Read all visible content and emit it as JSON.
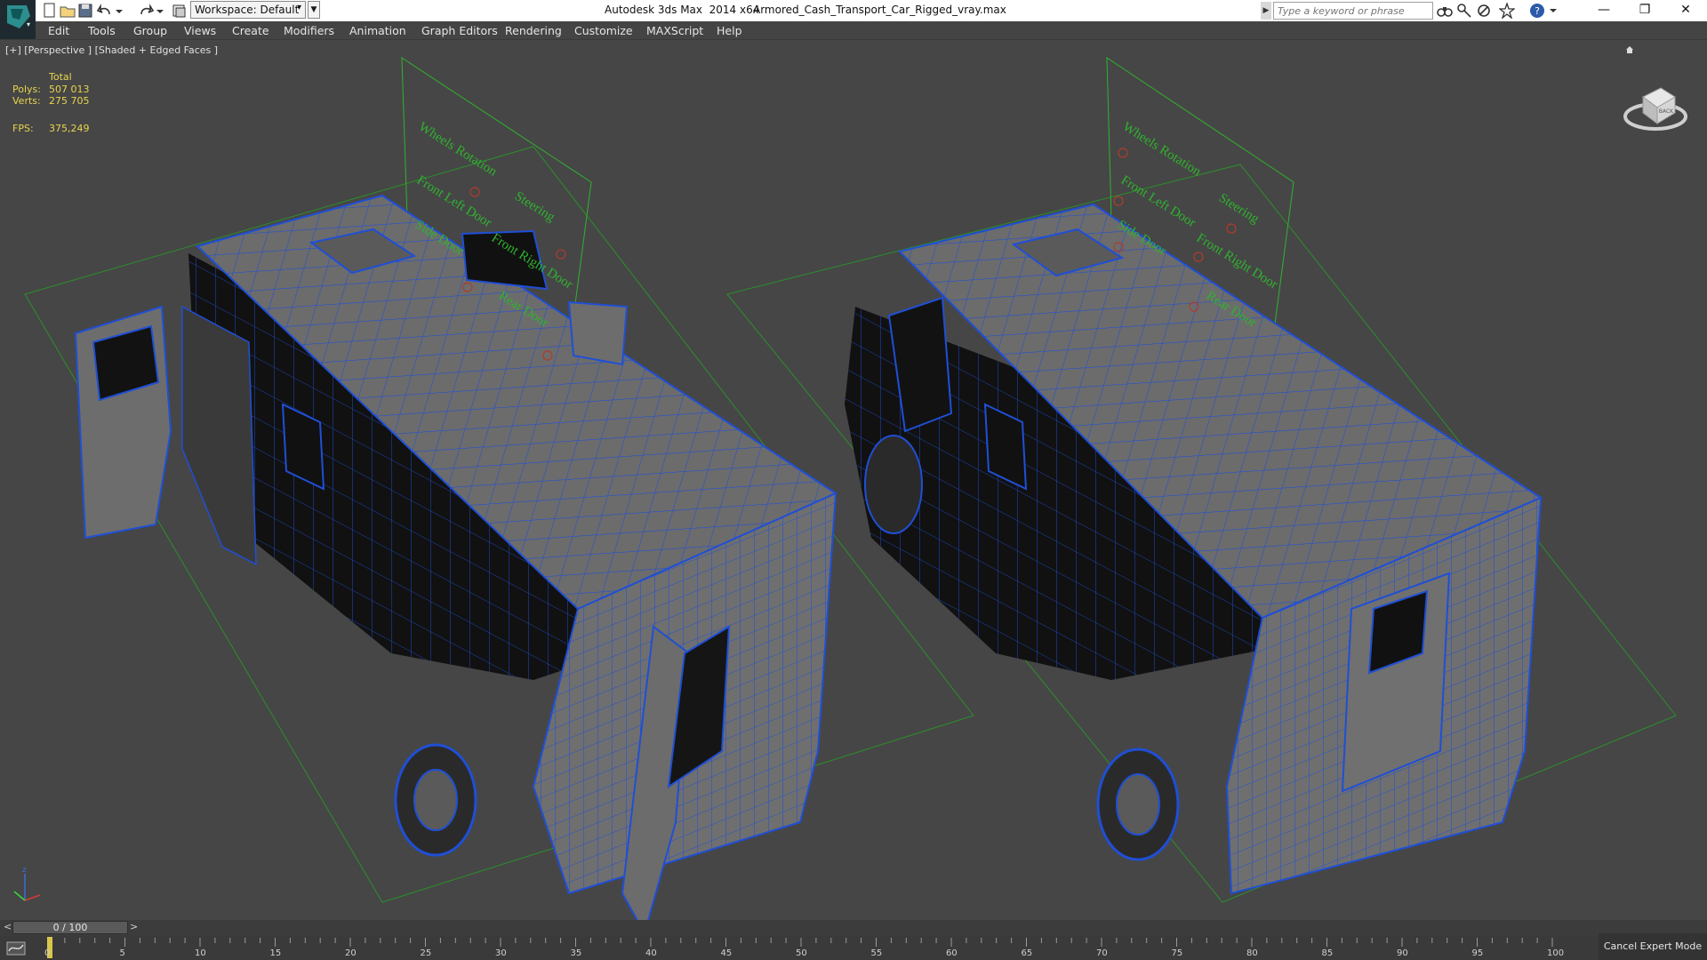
{
  "titlebar": {
    "workspace_label": "Workspace: Default",
    "app_title": "Autodesk 3ds Max  2014 x64",
    "file_title": "Armored_Cash_Transport_Car_Rigged_vray.max",
    "search_placeholder": "Type a keyword or phrase"
  },
  "menu": [
    "Edit",
    "Tools",
    "Group",
    "Views",
    "Create",
    "Modifiers",
    "Animation",
    "Graph Editors",
    "Rendering",
    "Customize",
    "MAXScript",
    "Help"
  ],
  "viewport": {
    "label": "[+] [Perspective ] [Shaded + Edged Faces ]",
    "stats": {
      "total_label": "Total",
      "polys_label": "Polys:",
      "polys_value": "507 013",
      "verts_label": "Verts:",
      "verts_value": "275 705",
      "fps_label": "FPS:",
      "fps_value": "375,249"
    },
    "rig_labels_left": [
      "Wheels Rotation",
      "Front Left Door",
      "Side Door",
      "Steering",
      "Front Right Door",
      "Rear Door"
    ],
    "rig_labels_right": [
      "Wheels Rotation",
      "Front Left Door",
      "Side Door",
      "Steering",
      "Front Right Door",
      "Rear Door"
    ],
    "viewcube_face": "BACK"
  },
  "timeline": {
    "frame_display": "0 / 100",
    "ticks": [
      "0",
      "5",
      "10",
      "15",
      "20",
      "25",
      "30",
      "35",
      "40",
      "45",
      "50",
      "55",
      "60",
      "65",
      "70",
      "75",
      "80",
      "85",
      "90",
      "95",
      "100"
    ],
    "current_frame": 0,
    "total_frames": 100
  },
  "status": {
    "cancel_expert": "Cancel Expert Mode"
  },
  "colors": {
    "wire": "#1f4fd6",
    "helper": "#2fb32f",
    "stats": "#e8d44d",
    "mesh": "#6e6e6e"
  }
}
